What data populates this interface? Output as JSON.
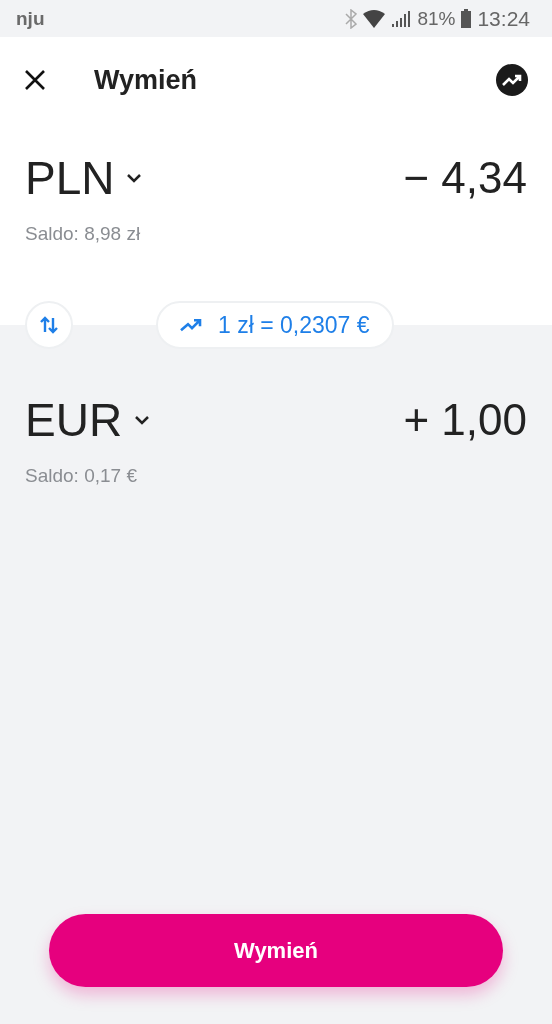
{
  "status_bar": {
    "carrier": "nju",
    "battery_percent": "81%",
    "time": "13:24"
  },
  "header": {
    "title": "Wymień"
  },
  "from": {
    "currency": "PLN",
    "amount": "− 4,34",
    "balance": "Saldo: 8,98 zł"
  },
  "rate": {
    "text": "1 zł = 0,2307 €"
  },
  "to": {
    "currency": "EUR",
    "amount": "+ 1,00",
    "balance": "Saldo: 0,17 €"
  },
  "action": {
    "label": "Wymień"
  }
}
